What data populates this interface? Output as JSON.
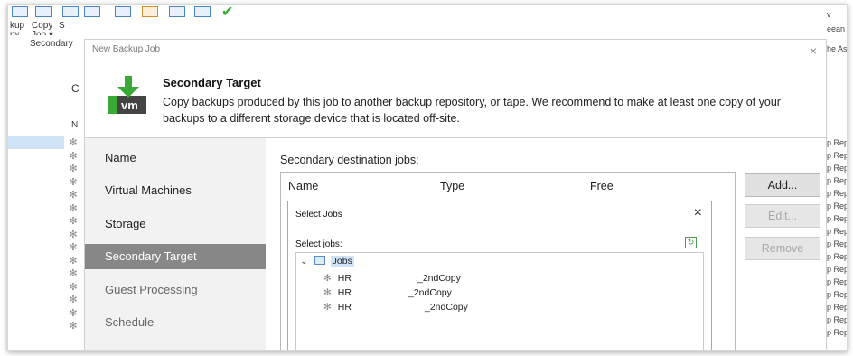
{
  "background": {
    "ribbon": [
      {
        "label": "kup",
        "sub": "py"
      },
      {
        "label": "Copy",
        "sub": "Job ▾"
      },
      {
        "label": "S",
        "sub": ""
      }
    ],
    "secondary_label": "Secondary",
    "left_letters": [
      "C",
      "N"
    ],
    "right_top": [
      "v",
      "eean",
      "he As"
    ],
    "right_rep_text": "p Rep"
  },
  "dialog": {
    "title": "New Backup Job",
    "close": "×",
    "header": {
      "icon_text": "vm",
      "title": "Secondary Target",
      "description": "Copy backups produced by this job to another backup repository, or tape. We recommend to make at least one copy of your backups to a different storage device that is located off-site."
    },
    "nav": [
      {
        "label": "Name",
        "state": "normal"
      },
      {
        "label": "Virtual Machines",
        "state": "normal"
      },
      {
        "label": "Storage",
        "state": "normal"
      },
      {
        "label": "Secondary Target",
        "state": "active"
      },
      {
        "label": "Guest Processing",
        "state": "dim"
      },
      {
        "label": "Schedule",
        "state": "dim"
      }
    ],
    "content_label": "Secondary destination jobs:",
    "columns": [
      "Name",
      "Type",
      "Free"
    ],
    "buttons": {
      "add": "Add...",
      "edit": "Edit...",
      "remove": "Remove"
    }
  },
  "select_jobs": {
    "title": "Select Jobs",
    "close": "×",
    "label": "Select jobs:",
    "root": "Jobs",
    "items": [
      {
        "name": "HR",
        "suffix": "_2ndCopy"
      },
      {
        "name": "HR",
        "suffix": "_2ndCopy"
      },
      {
        "name": "HR",
        "suffix": "_2ndCopy"
      }
    ]
  },
  "colors": {
    "active_nav": "#878787",
    "nav_bg": "#f2f2f2",
    "veeam_green": "#3aa935",
    "sub_border": "#7fb3e6"
  }
}
